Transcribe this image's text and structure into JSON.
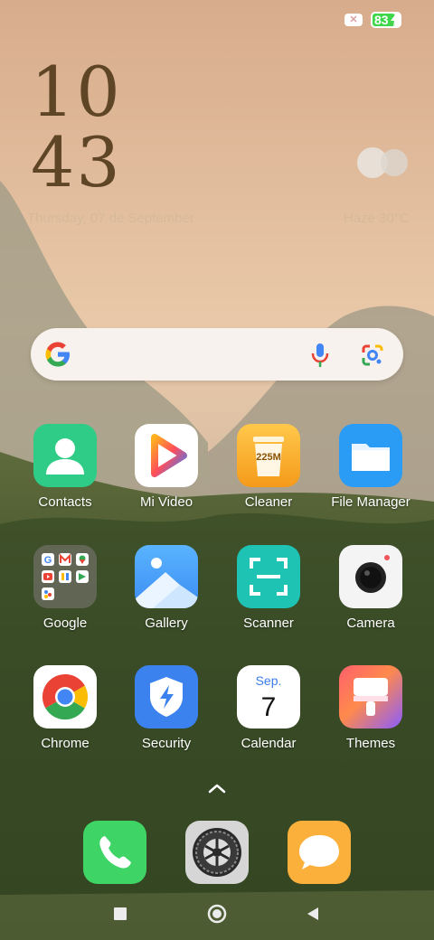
{
  "status_bar": {
    "battery_percent": "83",
    "battery_level": 0.83,
    "battery_color": "#3fd64b",
    "sim_icon": "no-sim-icon",
    "charging_icon": "bolt-icon"
  },
  "clock": {
    "hours": "10",
    "minutes": "43",
    "date": "Thursday, 07 de September"
  },
  "weather": {
    "text": "Haze 30°C",
    "icon": "haze-clouds-icon"
  },
  "search": {
    "logo": "google-g-logo",
    "mic_icon": "microphone-icon",
    "lens_icon": "google-lens-icon"
  },
  "apps": {
    "row1": [
      {
        "label": "Contacts",
        "icon": "contacts-icon",
        "color": "#2ecc86"
      },
      {
        "label": "Mi Video",
        "icon": "mi-video-play-icon",
        "color": "#ffffff"
      },
      {
        "label": "Cleaner",
        "icon": "cleaner-trash-icon",
        "color": "#f7a724",
        "badge": "225M"
      },
      {
        "label": "File Manager",
        "icon": "folder-icon",
        "color": "#3aa6f4"
      }
    ],
    "row2": [
      {
        "label": "Google",
        "icon": "google-folder-icon",
        "color": "#6b6b66"
      },
      {
        "label": "Gallery",
        "icon": "gallery-mountain-icon",
        "color": "#4fa7f6"
      },
      {
        "label": "Scanner",
        "icon": "scanner-frame-icon",
        "color": "#1fc4b4"
      },
      {
        "label": "Camera",
        "icon": "camera-lens-icon",
        "color": "#f2f2f2"
      }
    ],
    "row3": [
      {
        "label": "Chrome",
        "icon": "chrome-icon",
        "color": "#ffffff"
      },
      {
        "label": "Security",
        "icon": "security-shield-icon",
        "color": "#3d82f0"
      },
      {
        "label": "Calendar",
        "icon": "calendar-icon",
        "color": "#ffffff",
        "month": "Sep.",
        "day": "7"
      },
      {
        "label": "Themes",
        "icon": "themes-brush-icon",
        "color": "#ff6a6a"
      }
    ]
  },
  "drawer_handle": "chevron-up-icon",
  "dock": [
    {
      "name": "phone",
      "icon": "phone-icon",
      "color": "#3ed466"
    },
    {
      "name": "settings",
      "icon": "settings-gear-icon",
      "color": "#d8d8d8"
    },
    {
      "name": "messaging",
      "icon": "message-bubble-icon",
      "color": "#fbb03b"
    }
  ],
  "nav": {
    "recents_icon": "square-recents-icon",
    "home_icon": "circle-home-icon",
    "back_icon": "triangle-back-icon"
  }
}
